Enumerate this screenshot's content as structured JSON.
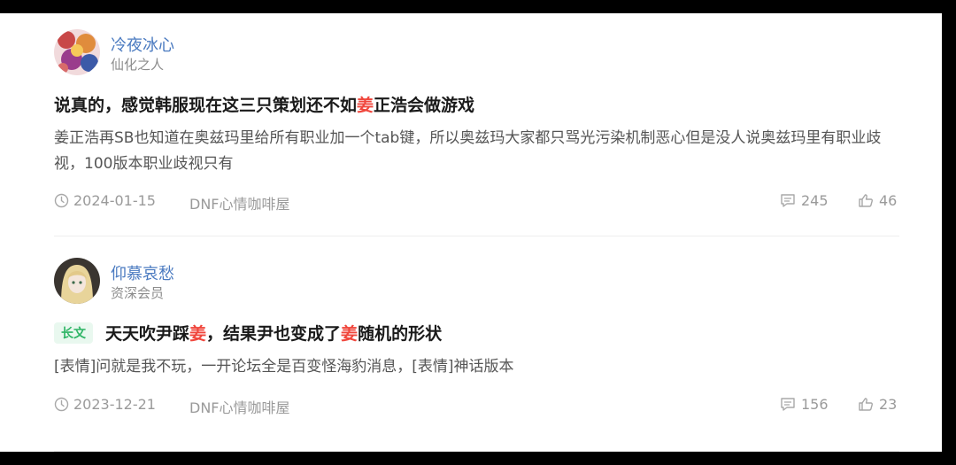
{
  "posts": [
    {
      "username": "冷夜冰心",
      "user_title": "仙化之人",
      "title_before": "说真的，感觉韩服现在这三只策划还不如",
      "title_hl": "姜",
      "title_after": "正浩会做游戏",
      "excerpt": "姜正浩再SB也知道在奥兹玛里给所有职业加一个tab键，所以奥兹玛大家都只骂光污染机制恶心但是没人说奥兹玛里有职业歧视，100版本职业歧视只有",
      "date": "2024-01-15",
      "forum": "DNF心情咖啡屋",
      "comments": "245",
      "likes": "46",
      "highlight_color": "#f0463c"
    },
    {
      "username": "仰慕哀愁",
      "user_title": "资深会员",
      "tag": "长文",
      "title_p1": "天天吹尹踩",
      "title_hl1": "姜",
      "title_p2": "，结果尹也变成了",
      "title_hl2": "姜",
      "title_p3": "随机的形状",
      "excerpt": "[表情]问就是我不玩，一开论坛全是百变怪海豹消息，[表情]神话版本",
      "date": "2023-12-21",
      "forum": "DNF心情咖啡屋",
      "comments": "156",
      "likes": "23"
    }
  ],
  "icons": {
    "date": "clock-icon",
    "comments": "comment-icon",
    "likes": "thumbs-up-icon"
  },
  "colors": {
    "username": "#4a7ac0",
    "tag_bg": "#e9f8ef",
    "tag_fg": "#2fb566"
  }
}
